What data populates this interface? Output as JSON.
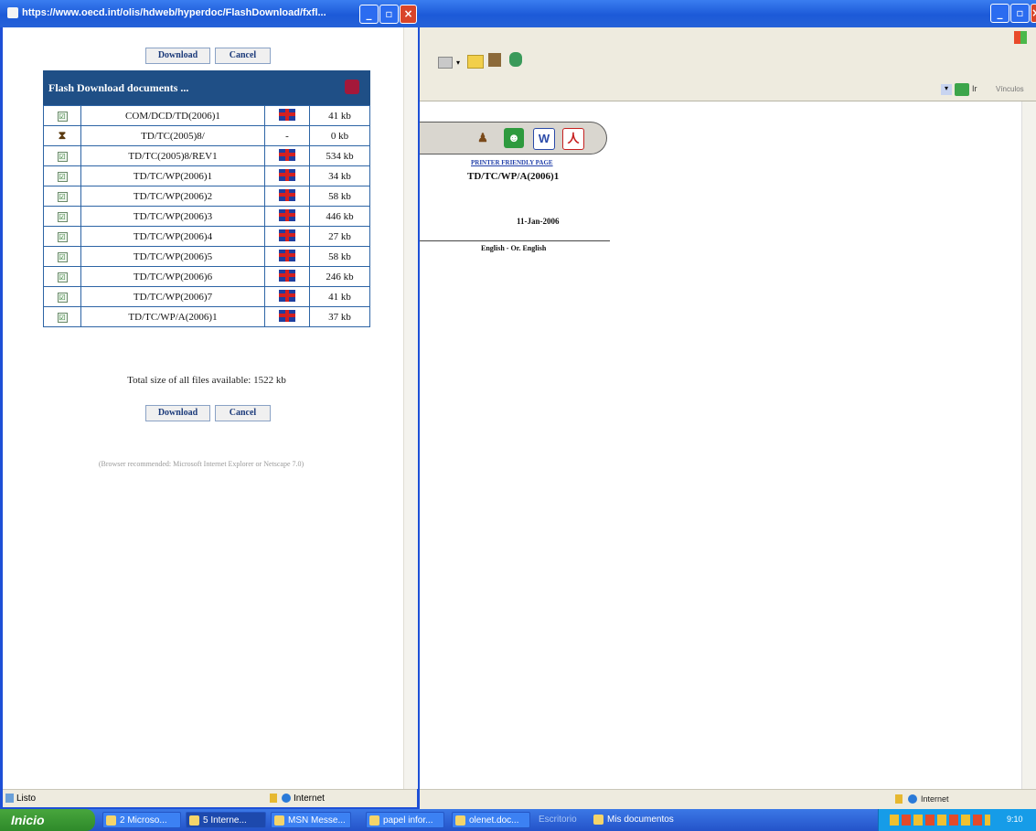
{
  "popup": {
    "title": "https://www.oecd.int/olis/hdweb/hyperdoc/FlashDownload/fxfl...",
    "top_buttons": {
      "download": "Download",
      "cancel": "Cancel"
    },
    "panel_title": "Flash Download documents ...",
    "rows": [
      {
        "check": "☑",
        "name": "COM/DCD/TD(2006)1",
        "lang": "EN",
        "size": "41 kb"
      },
      {
        "check": "⧗",
        "name": "TD/TC(2005)8/",
        "lang": "-",
        "size": "0 kb"
      },
      {
        "check": "☑",
        "name": "TD/TC(2005)8/REV1",
        "lang": "EN",
        "size": "534 kb"
      },
      {
        "check": "☑",
        "name": "TD/TC/WP(2006)1",
        "lang": "EN",
        "size": "34 kb"
      },
      {
        "check": "☑",
        "name": "TD/TC/WP(2006)2",
        "lang": "EN",
        "size": "58 kb"
      },
      {
        "check": "☑",
        "name": "TD/TC/WP(2006)3",
        "lang": "EN",
        "size": "446 kb"
      },
      {
        "check": "☑",
        "name": "TD/TC/WP(2006)4",
        "lang": "EN",
        "size": "27 kb"
      },
      {
        "check": "☑",
        "name": "TD/TC/WP(2006)5",
        "lang": "EN",
        "size": "58 kb"
      },
      {
        "check": "☑",
        "name": "TD/TC/WP(2006)6",
        "lang": "EN",
        "size": "246 kb"
      },
      {
        "check": "☑",
        "name": "TD/TC/WP(2006)7",
        "lang": "EN",
        "size": "41 kb"
      },
      {
        "check": "☑",
        "name": "TD/TC/WP/A(2006)1",
        "lang": "EN",
        "size": "37 kb"
      }
    ],
    "total_text": "Total size of all files available: 1522 kb",
    "bottom_buttons": {
      "download": "Download",
      "cancel": "Cancel"
    },
    "browser_note": "(Browser recommended: Microsoft Internet Explorer or Netscape 7.0)",
    "status": {
      "left": "Listo",
      "zone": "Internet"
    }
  },
  "main_window": {
    "address_go": "Ir",
    "address_links": "Vínculos",
    "printer_link": "PRINTER FRIENDLY PAGE",
    "doc_ref": "TD/TC/WP/A(2006)1",
    "doc_date": "11-Jan-2006",
    "doc_lang": "English - Or. English",
    "status_zone": "Internet"
  },
  "taskbar": {
    "start": "Inicio",
    "tasks": [
      "2 Microso...",
      "5 Interne...",
      "MSN Messe...",
      "papel infor...",
      "olenet.doc...",
      "Escritorio",
      "Mis documentos"
    ],
    "tray_time": "9:10"
  },
  "colors": {
    "xp_blue": "#1c5ad8",
    "panel_header": "#1f4f86",
    "table_border": "#2d64a5"
  }
}
